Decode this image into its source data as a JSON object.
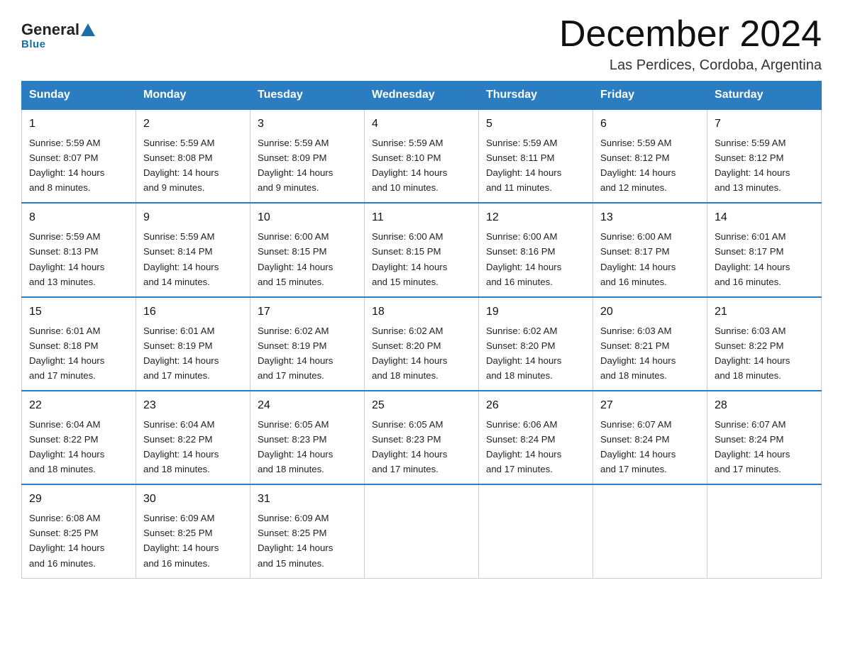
{
  "header": {
    "logo": {
      "general": "General",
      "blue": "Blue"
    },
    "title": "December 2024",
    "location": "Las Perdices, Cordoba, Argentina"
  },
  "days_of_week": [
    "Sunday",
    "Monday",
    "Tuesday",
    "Wednesday",
    "Thursday",
    "Friday",
    "Saturday"
  ],
  "weeks": [
    [
      {
        "day": "1",
        "sunrise": "5:59 AM",
        "sunset": "8:07 PM",
        "daylight": "14 hours and 8 minutes."
      },
      {
        "day": "2",
        "sunrise": "5:59 AM",
        "sunset": "8:08 PM",
        "daylight": "14 hours and 9 minutes."
      },
      {
        "day": "3",
        "sunrise": "5:59 AM",
        "sunset": "8:09 PM",
        "daylight": "14 hours and 9 minutes."
      },
      {
        "day": "4",
        "sunrise": "5:59 AM",
        "sunset": "8:10 PM",
        "daylight": "14 hours and 10 minutes."
      },
      {
        "day": "5",
        "sunrise": "5:59 AM",
        "sunset": "8:11 PM",
        "daylight": "14 hours and 11 minutes."
      },
      {
        "day": "6",
        "sunrise": "5:59 AM",
        "sunset": "8:12 PM",
        "daylight": "14 hours and 12 minutes."
      },
      {
        "day": "7",
        "sunrise": "5:59 AM",
        "sunset": "8:12 PM",
        "daylight": "14 hours and 13 minutes."
      }
    ],
    [
      {
        "day": "8",
        "sunrise": "5:59 AM",
        "sunset": "8:13 PM",
        "daylight": "14 hours and 13 minutes."
      },
      {
        "day": "9",
        "sunrise": "5:59 AM",
        "sunset": "8:14 PM",
        "daylight": "14 hours and 14 minutes."
      },
      {
        "day": "10",
        "sunrise": "6:00 AM",
        "sunset": "8:15 PM",
        "daylight": "14 hours and 15 minutes."
      },
      {
        "day": "11",
        "sunrise": "6:00 AM",
        "sunset": "8:15 PM",
        "daylight": "14 hours and 15 minutes."
      },
      {
        "day": "12",
        "sunrise": "6:00 AM",
        "sunset": "8:16 PM",
        "daylight": "14 hours and 16 minutes."
      },
      {
        "day": "13",
        "sunrise": "6:00 AM",
        "sunset": "8:17 PM",
        "daylight": "14 hours and 16 minutes."
      },
      {
        "day": "14",
        "sunrise": "6:01 AM",
        "sunset": "8:17 PM",
        "daylight": "14 hours and 16 minutes."
      }
    ],
    [
      {
        "day": "15",
        "sunrise": "6:01 AM",
        "sunset": "8:18 PM",
        "daylight": "14 hours and 17 minutes."
      },
      {
        "day": "16",
        "sunrise": "6:01 AM",
        "sunset": "8:19 PM",
        "daylight": "14 hours and 17 minutes."
      },
      {
        "day": "17",
        "sunrise": "6:02 AM",
        "sunset": "8:19 PM",
        "daylight": "14 hours and 17 minutes."
      },
      {
        "day": "18",
        "sunrise": "6:02 AM",
        "sunset": "8:20 PM",
        "daylight": "14 hours and 18 minutes."
      },
      {
        "day": "19",
        "sunrise": "6:02 AM",
        "sunset": "8:20 PM",
        "daylight": "14 hours and 18 minutes."
      },
      {
        "day": "20",
        "sunrise": "6:03 AM",
        "sunset": "8:21 PM",
        "daylight": "14 hours and 18 minutes."
      },
      {
        "day": "21",
        "sunrise": "6:03 AM",
        "sunset": "8:22 PM",
        "daylight": "14 hours and 18 minutes."
      }
    ],
    [
      {
        "day": "22",
        "sunrise": "6:04 AM",
        "sunset": "8:22 PM",
        "daylight": "14 hours and 18 minutes."
      },
      {
        "day": "23",
        "sunrise": "6:04 AM",
        "sunset": "8:22 PM",
        "daylight": "14 hours and 18 minutes."
      },
      {
        "day": "24",
        "sunrise": "6:05 AM",
        "sunset": "8:23 PM",
        "daylight": "14 hours and 18 minutes."
      },
      {
        "day": "25",
        "sunrise": "6:05 AM",
        "sunset": "8:23 PM",
        "daylight": "14 hours and 17 minutes."
      },
      {
        "day": "26",
        "sunrise": "6:06 AM",
        "sunset": "8:24 PM",
        "daylight": "14 hours and 17 minutes."
      },
      {
        "day": "27",
        "sunrise": "6:07 AM",
        "sunset": "8:24 PM",
        "daylight": "14 hours and 17 minutes."
      },
      {
        "day": "28",
        "sunrise": "6:07 AM",
        "sunset": "8:24 PM",
        "daylight": "14 hours and 17 minutes."
      }
    ],
    [
      {
        "day": "29",
        "sunrise": "6:08 AM",
        "sunset": "8:25 PM",
        "daylight": "14 hours and 16 minutes."
      },
      {
        "day": "30",
        "sunrise": "6:09 AM",
        "sunset": "8:25 PM",
        "daylight": "14 hours and 16 minutes."
      },
      {
        "day": "31",
        "sunrise": "6:09 AM",
        "sunset": "8:25 PM",
        "daylight": "14 hours and 15 minutes."
      },
      null,
      null,
      null,
      null
    ]
  ]
}
